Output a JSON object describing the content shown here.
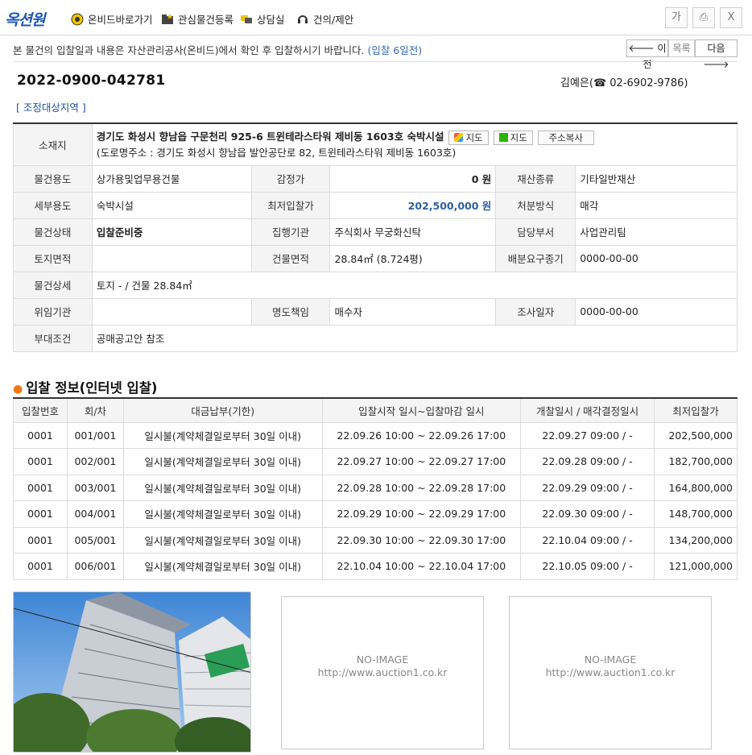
{
  "header": {
    "logo": "옥션원",
    "nav": [
      {
        "label": "온비드바로가기",
        "icon": "onbid-icon"
      },
      {
        "label": "관심물건등록",
        "icon": "folder-star-icon"
      },
      {
        "label": "상담실",
        "icon": "chat-icon"
      },
      {
        "label": "건의/제안",
        "icon": "headset-icon"
      }
    ],
    "tools": [
      "가",
      "⎙",
      "X"
    ]
  },
  "notice": {
    "text": "본 물건의 입찰일과 내용은 자산관리공사(온비드)에서 확인 후 입찰하시기 바랍니다.",
    "highlight": "(입찰 6일전)"
  },
  "pager": {
    "prev": "🡐 이전",
    "list": "목록",
    "next": "다음 🡒"
  },
  "case": {
    "number": "2022-0900-042781",
    "contact_name": "김예은(",
    "contact_phone": "☎ 02-6902-9786)",
    "region_tag": "[ 조정대상지역 ]"
  },
  "info": {
    "address_label": "소재지",
    "address": "경기도 화성시 향남읍 구문천리 925-6 트윈테라스타워 제비동 1603호 숙박시설",
    "road_address": "(도로명주소 : 경기도 화성시 향남읍 발안공단로 82, 트윈테라스타워 제비동 1603호)",
    "btn_daum_map": "지도",
    "btn_naver_map": "지도",
    "btn_copy": "주소복사",
    "rows": [
      {
        "l1": "물건용도",
        "v1": "상가용및업무용건물",
        "l2": "감정가",
        "v2": "0 원",
        "l3": "재산종류",
        "v3": "기타일반재산"
      },
      {
        "l1": "세부용도",
        "v1": "숙박시설",
        "l2": "최저입찰가",
        "v2": "202,500,000 원",
        "l3": "처분방식",
        "v3": "매각"
      },
      {
        "l1": "물건상태",
        "v1": "입찰준비중",
        "l2": "집행기관",
        "v2": "주식회사 무궁화신탁",
        "l3": "담당부서",
        "v3": "사업관리팀"
      },
      {
        "l1": "토지면적",
        "v1": "",
        "l2": "건물면적",
        "v2": "28.84㎡ (8.724평)",
        "l3": "배분요구종기",
        "v3": "0000-00-00"
      }
    ],
    "detail_label": "물건상세",
    "detail": "토지 - / 건물 28.84㎡",
    "row_delegate": {
      "l1": "위임기관",
      "v1": "",
      "l2": "명도책임",
      "v2": "매수자",
      "l3": "조사일자",
      "v3": "0000-00-00"
    },
    "cond_label": "부대조건",
    "cond": "공매공고안 참조"
  },
  "bid_section": {
    "title": "입찰 정보(인터넷 입찰)",
    "headers": [
      "입찰번호",
      "회/차",
      "대금납부(기한)",
      "입찰시작 일시~입찰마감 일시",
      "개찰일시 / 매각결정일시",
      "최저입찰가"
    ],
    "rows": [
      [
        "0001",
        "001/001",
        "일시불(계약체결일로부터 30일 이내)",
        "22.09.26 10:00 ~ 22.09.26 17:00",
        "22.09.27 09:00 / -",
        "202,500,000"
      ],
      [
        "0001",
        "002/001",
        "일시불(계약체결일로부터 30일 이내)",
        "22.09.27 10:00 ~ 22.09.27 17:00",
        "22.09.28 09:00 / -",
        "182,700,000"
      ],
      [
        "0001",
        "003/001",
        "일시불(계약체결일로부터 30일 이내)",
        "22.09.28 10:00 ~ 22.09.28 17:00",
        "22.09.29 09:00 / -",
        "164,800,000"
      ],
      [
        "0001",
        "004/001",
        "일시불(계약체결일로부터 30일 이내)",
        "22.09.29 10:00 ~ 22.09.29 17:00",
        "22.09.30 09:00 / -",
        "148,700,000"
      ],
      [
        "0001",
        "005/001",
        "일시불(계약체결일로부터 30일 이내)",
        "22.09.30 10:00 ~ 22.09.30 17:00",
        "22.10.04 09:00 / -",
        "134,200,000"
      ],
      [
        "0001",
        "006/001",
        "일시불(계약체결일로부터 30일 이내)",
        "22.10.04 10:00 ~ 22.10.04 17:00",
        "22.10.05 09:00 / -",
        "121,000,000"
      ]
    ]
  },
  "images": {
    "noimage_text": "NO-IMAGE",
    "noimage_url": "http://www.auction1.co.kr"
  },
  "colors": {
    "accent": "#1f56b3",
    "link": "#2f5f9e",
    "bullet": "#f07a1a"
  }
}
